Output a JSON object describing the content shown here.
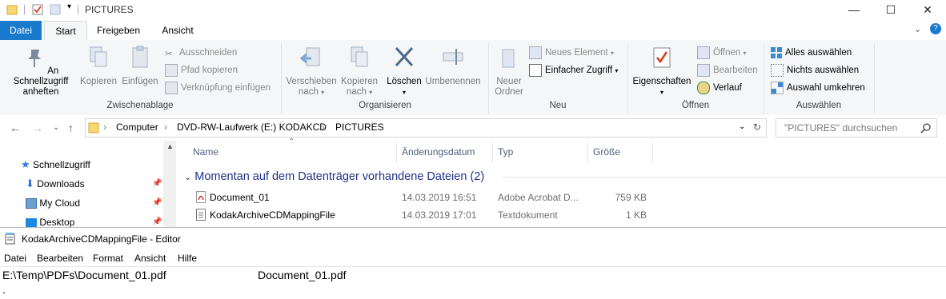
{
  "explorer": {
    "title": "PICTURES",
    "window_controls": [
      "—",
      "☐",
      "✕"
    ]
  },
  "tabs": [
    {
      "label": "Datei"
    },
    {
      "label": "Start"
    },
    {
      "label": "Freigeben"
    },
    {
      "label": "Ansicht"
    }
  ],
  "ribbon": {
    "zwischenablage": {
      "label": "Zwischenablage",
      "pin": "An Schnellzugriff anheften",
      "copy": "Kopieren",
      "paste": "Einfügen",
      "cut": "Ausschneiden",
      "copy_path": "Pfad kopieren",
      "paste_shortcut": "Verknüpfung einfügen"
    },
    "organisieren": {
      "label": "Organisieren",
      "move": "Verschieben nach",
      "copy_to": "Kopieren nach",
      "delete": "Löschen",
      "rename": "Umbenennen"
    },
    "neu": {
      "label": "Neu",
      "new_folder": "Neuer Ordner",
      "new_item": "Neues Element",
      "easy_access": "Einfacher Zugriff"
    },
    "oeffnen": {
      "label": "Öffnen",
      "properties": "Eigenschaften",
      "open": "Öffnen",
      "edit": "Bearbeiten",
      "history": "Verlauf"
    },
    "auswaehlen": {
      "label": "Auswählen",
      "select_all": "Alles auswählen",
      "select_none": "Nichts auswählen",
      "invert": "Auswahl umkehren"
    }
  },
  "address": {
    "crumbs": [
      "Computer",
      "DVD-RW-Laufwerk (E:) KODAKCD",
      "PICTURES"
    ],
    "search_placeholder": "\"PICTURES\" durchsuchen"
  },
  "navpane": {
    "items": [
      {
        "label": "Schnellzugriff"
      },
      {
        "label": "Downloads"
      },
      {
        "label": "My Cloud"
      },
      {
        "label": "Desktop"
      }
    ]
  },
  "filelist": {
    "columns": [
      "Name",
      "Änderungsdatum",
      "Typ",
      "Größe"
    ],
    "group": "Momentan auf dem Datenträger vorhandene Dateien (2)",
    "rows": [
      {
        "name": "Document_01",
        "date": "14.03.2019 16:51",
        "type": "Adobe Acrobat D...",
        "size": "759 KB"
      },
      {
        "name": "KodakArchiveCDMappingFile",
        "date": "14.03.2019 17:01",
        "type": "Textdokument",
        "size": "1 KB"
      }
    ]
  },
  "notepad": {
    "title": "KodakArchiveCDMappingFile - Editor",
    "menu": [
      "Datei",
      "Bearbeiten",
      "Format",
      "Ansicht",
      "Hilfe"
    ],
    "line_path": "E:\\Temp\\PDFs\\Document_01.pdf",
    "line_name": "Document_01.pdf",
    "line2": "."
  },
  "colors": {
    "file_tab": "#1979ca",
    "group_header": "#1e3287",
    "ribbon_bg": "#f5f6f7"
  }
}
